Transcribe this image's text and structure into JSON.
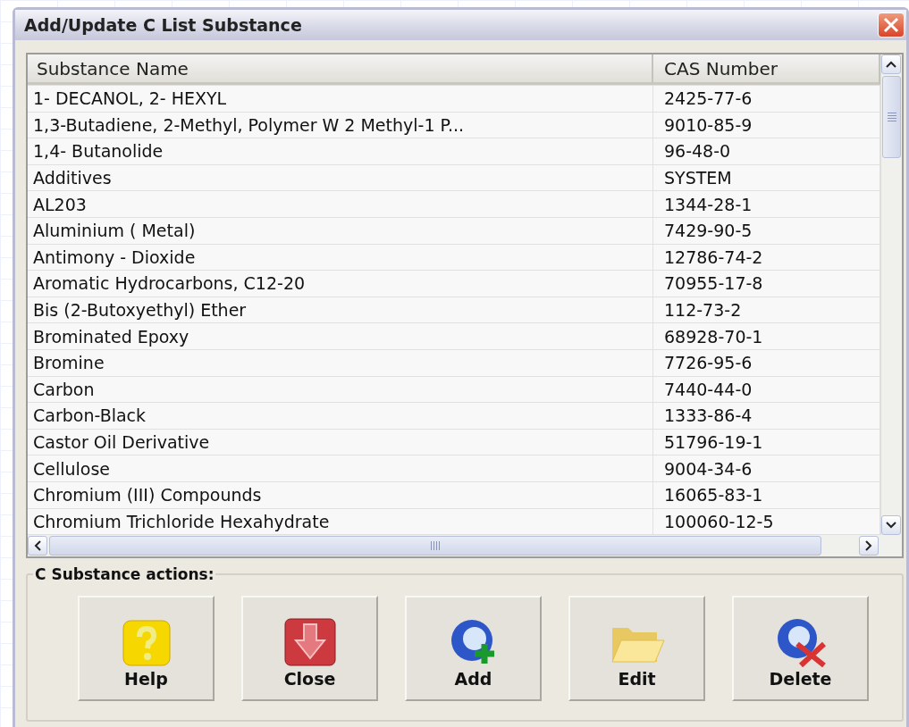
{
  "window": {
    "title": "Add/Update C List Substance"
  },
  "table": {
    "columns": [
      "Substance Name",
      "CAS Number"
    ],
    "rows": [
      {
        "name": "1- DECANOL, 2- HEXYL",
        "cas": "2425-77-6"
      },
      {
        "name": "1,3-Butadiene, 2-Methyl, Polymer W 2 Methyl-1 P...",
        "cas": "9010-85-9"
      },
      {
        "name": "1,4- Butanolide",
        "cas": "96-48-0"
      },
      {
        "name": "Additives",
        "cas": "SYSTEM"
      },
      {
        "name": "AL203",
        "cas": "1344-28-1"
      },
      {
        "name": "Aluminium ( Metal)",
        "cas": "7429-90-5"
      },
      {
        "name": "Antimony - Dioxide",
        "cas": "12786-74-2"
      },
      {
        "name": "Aromatic Hydrocarbons, C12-20",
        "cas": "70955-17-8"
      },
      {
        "name": "Bis (2-Butoxyethyl) Ether",
        "cas": "112-73-2"
      },
      {
        "name": "Brominated Epoxy",
        "cas": "68928-70-1"
      },
      {
        "name": "Bromine",
        "cas": "7726-95-6"
      },
      {
        "name": "Carbon",
        "cas": "7440-44-0"
      },
      {
        "name": "Carbon-Black",
        "cas": "1333-86-4"
      },
      {
        "name": "Castor Oil Derivative",
        "cas": "51796-19-1"
      },
      {
        "name": "Cellulose",
        "cas": "9004-34-6"
      },
      {
        "name": "Chromium (III) Compounds",
        "cas": "16065-83-1"
      },
      {
        "name": "Chromium Trichloride Hexahydrate",
        "cas": "100060-12-5"
      }
    ]
  },
  "actions": {
    "title": "C Substance actions:",
    "buttons": [
      {
        "kind": "help",
        "label": "Help"
      },
      {
        "kind": "close",
        "label": "Close"
      },
      {
        "kind": "add",
        "label": "Add"
      },
      {
        "kind": "edit",
        "label": "Edit"
      },
      {
        "kind": "delete",
        "label": "Delete"
      }
    ]
  }
}
